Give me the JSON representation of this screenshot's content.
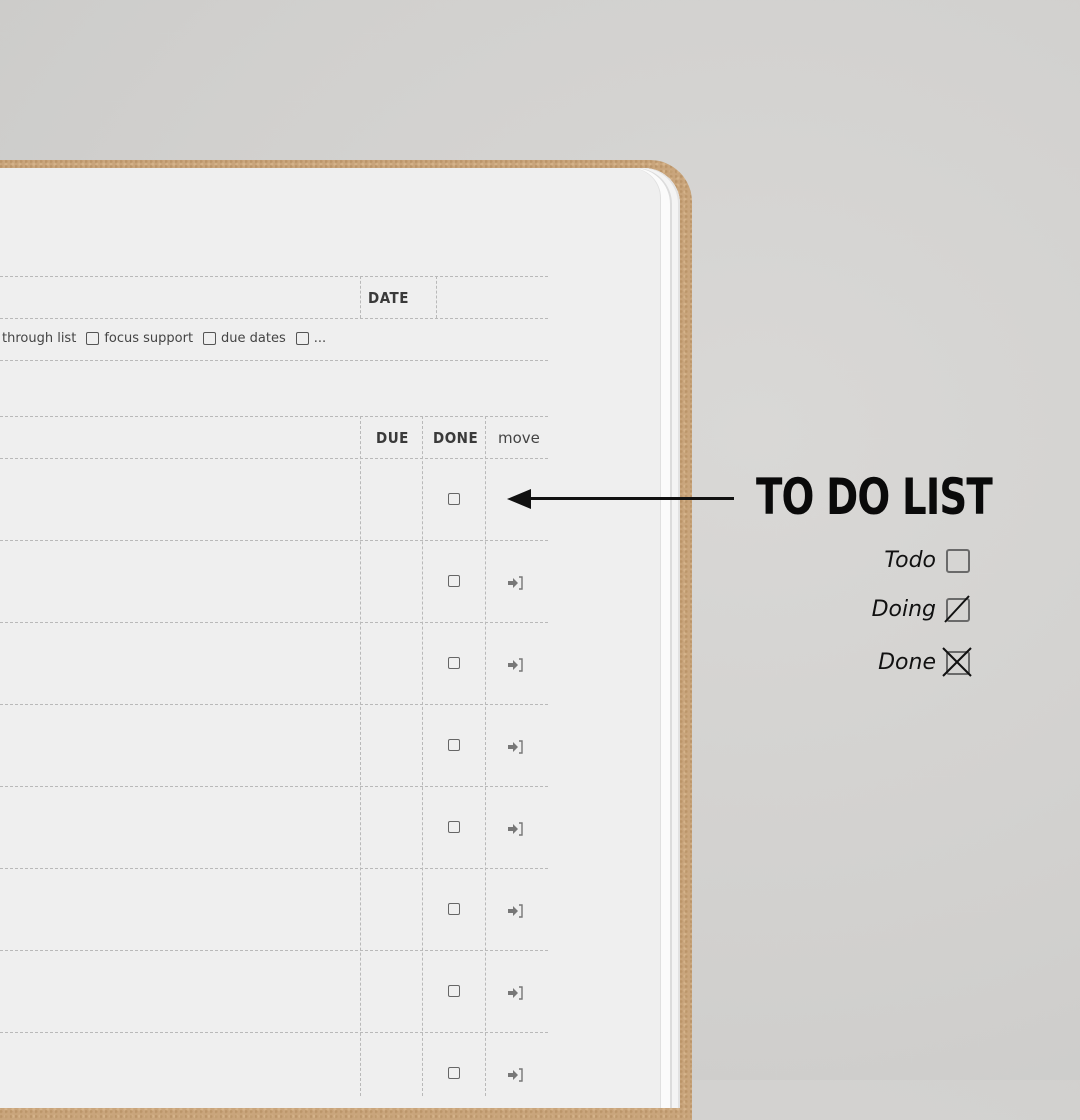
{
  "header": {
    "date_label": "DATE",
    "options": [
      {
        "label": "through list",
        "checkbox": false,
        "checked": false
      },
      {
        "label": "focus support",
        "checkbox": true,
        "checked": false
      },
      {
        "label": "due dates",
        "checkbox": true,
        "checked": false
      },
      {
        "label": "...",
        "checkbox": true,
        "checked": false
      }
    ]
  },
  "table": {
    "columns": [
      "DUE",
      "DONE",
      "move"
    ],
    "rows": [
      {
        "due": "",
        "done": false,
        "move_icon": "move-arrow-icon"
      },
      {
        "due": "",
        "done": false,
        "move_icon": "move-arrow-icon"
      },
      {
        "due": "",
        "done": false,
        "move_icon": "move-arrow-icon"
      },
      {
        "due": "",
        "done": false,
        "move_icon": "move-arrow-icon"
      },
      {
        "due": "",
        "done": false,
        "move_icon": "move-arrow-icon"
      },
      {
        "due": "",
        "done": false,
        "move_icon": "move-arrow-icon"
      },
      {
        "due": "",
        "done": false,
        "move_icon": "move-arrow-icon"
      },
      {
        "due": "",
        "done": false,
        "move_icon": "move-arrow-icon"
      }
    ]
  },
  "annotation": {
    "title": "TO DO LIST",
    "legend": [
      {
        "label": "Todo",
        "state": "empty"
      },
      {
        "label": "Doing",
        "state": "slash"
      },
      {
        "label": "Done",
        "state": "cross"
      }
    ]
  },
  "colors": {
    "cork": "#c9a57c",
    "paper": "#efefef",
    "background": "#d2d1cf",
    "ink": "#111111"
  }
}
